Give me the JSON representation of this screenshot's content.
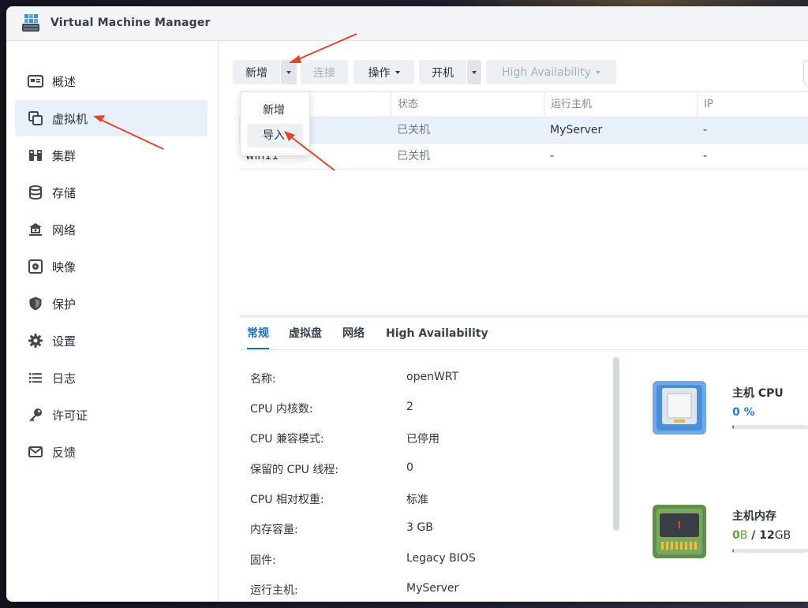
{
  "window": {
    "title": "Virtual Machine Manager"
  },
  "sidebar": {
    "items": [
      {
        "label": "概述",
        "icon": "overview-icon"
      },
      {
        "label": "虚拟机",
        "icon": "vm-icon",
        "active": true
      },
      {
        "label": "集群",
        "icon": "cluster-icon"
      },
      {
        "label": "存储",
        "icon": "storage-icon"
      },
      {
        "label": "网络",
        "icon": "network-icon"
      },
      {
        "label": "映像",
        "icon": "image-icon"
      },
      {
        "label": "保护",
        "icon": "shield-icon"
      },
      {
        "label": "设置",
        "icon": "gear-icon"
      },
      {
        "label": "日志",
        "icon": "log-icon"
      },
      {
        "label": "许可证",
        "icon": "key-icon"
      },
      {
        "label": "反馈",
        "icon": "mail-icon"
      }
    ]
  },
  "toolbar": {
    "add": "新增",
    "connect": "连接",
    "action": "操作",
    "power_on": "开机",
    "high_availability": "High Availability"
  },
  "dropdown": {
    "items": [
      "新增",
      "导入"
    ]
  },
  "table": {
    "columns": [
      "状态",
      "运行主机",
      "IP"
    ],
    "rows": [
      {
        "name": "",
        "status": "已关机",
        "host": "MyServer",
        "ip": "-"
      },
      {
        "name": "win11",
        "status": "已关机",
        "host": "-",
        "ip": "-"
      }
    ]
  },
  "tabs": [
    "常规",
    "虚拟盘",
    "网络",
    "High Availability"
  ],
  "details": [
    {
      "label": "名称:",
      "value": "openWRT"
    },
    {
      "label": "CPU 内核数:",
      "value": "2"
    },
    {
      "label": "CPU 兼容模式:",
      "value": "已停用"
    },
    {
      "label": "保留的 CPU 线程:",
      "value": "0"
    },
    {
      "label": "CPU 相对权重:",
      "value": "标准"
    },
    {
      "label": "内存容量:",
      "value": "3 GB"
    },
    {
      "label": "固件:",
      "value": "Legacy BIOS"
    },
    {
      "label": "运行主机:",
      "value": "MyServer"
    }
  ],
  "usage": {
    "cpu": {
      "title": "主机 CPU",
      "value": "0",
      "unit": "%",
      "color": "#2b7ad6"
    },
    "ram": {
      "title": "主机内存",
      "used": "0",
      "used_unit": "B",
      "sep": "/",
      "total": "12",
      "total_unit": "GB",
      "color": "#5aa839"
    }
  },
  "cpu_usage": 0.02,
  "ram_usage": 0.02,
  "colors": {
    "accent": "#1a73c7",
    "annotation": "#e0442b"
  }
}
